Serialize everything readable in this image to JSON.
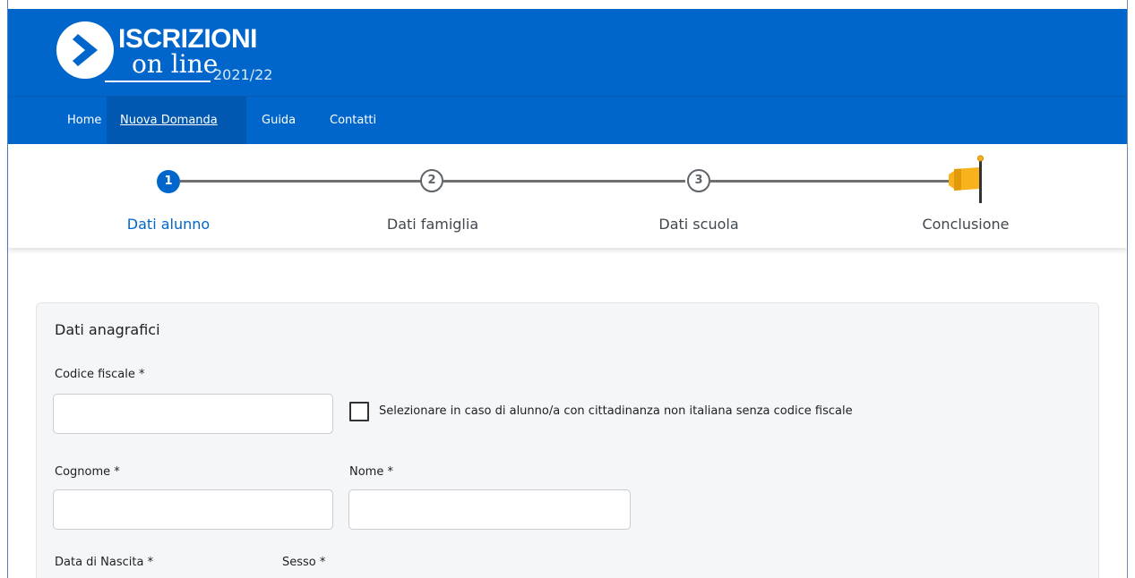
{
  "header": {
    "title": "ISCRIZIONI",
    "subtitle": "on line",
    "year": "2021/22",
    "brand_color": "#0066cc"
  },
  "nav": {
    "items": [
      {
        "label": "Home",
        "active": false
      },
      {
        "label": "Nuova Domanda",
        "active": true
      },
      {
        "label": "Guida",
        "active": false
      },
      {
        "label": "Contatti",
        "active": false
      }
    ]
  },
  "stepper": {
    "steps": [
      {
        "number": "1",
        "label": "Dati alunno",
        "active": true
      },
      {
        "number": "2",
        "label": "Dati famiglia",
        "active": false
      },
      {
        "number": "3",
        "label": "Dati scuola",
        "active": false
      },
      {
        "number": "",
        "label": "Conclusione",
        "active": false,
        "icon": "flag-icon"
      }
    ],
    "active_color": "#0066cc",
    "flag_color": "#f7b21c"
  },
  "form": {
    "section_title": "Dati anagrafici",
    "codice_fiscale": {
      "label": "Codice fiscale *",
      "value": ""
    },
    "foreign_checkbox": {
      "label": "Selezionare in caso di alunno/a con cittadinanza non italiana senza codice fiscale",
      "checked": false
    },
    "cognome": {
      "label": "Cognome *",
      "value": ""
    },
    "nome": {
      "label": "Nome *",
      "value": ""
    },
    "data_nascita": {
      "label": "Data di Nascita *"
    },
    "sesso": {
      "label": "Sesso *"
    }
  }
}
